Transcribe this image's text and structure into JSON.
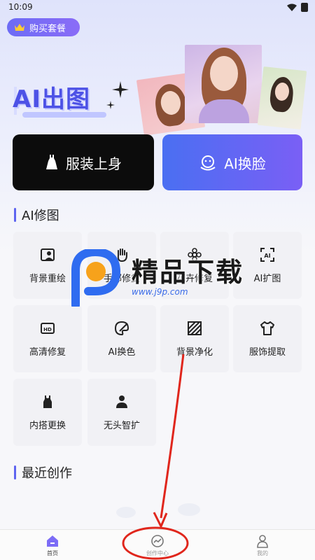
{
  "status": {
    "time": "10:09"
  },
  "header": {
    "buy_label": "购买套餐"
  },
  "banner": {
    "title": "AI出图"
  },
  "actions": {
    "clothes_label": "服装上身",
    "faceswap_label": "AI换脸"
  },
  "retouch": {
    "title": "AI修图",
    "tools": [
      {
        "label": "背景重绘",
        "icon": "portrait-icon"
      },
      {
        "label": "手部修复",
        "icon": "hand-icon"
      },
      {
        "label": "花卉修复",
        "icon": "flower-icon"
      },
      {
        "label": "AI扩图",
        "icon": "expand-icon"
      },
      {
        "label": "高清修复",
        "icon": "hd-icon"
      },
      {
        "label": "AI换色",
        "icon": "palette-icon"
      },
      {
        "label": "背景净化",
        "icon": "stripes-icon"
      },
      {
        "label": "服饰提取",
        "icon": "shirt-icon"
      },
      {
        "label": "内搭更换",
        "icon": "tanktop-icon"
      },
      {
        "label": "无头智扩",
        "icon": "person-icon"
      }
    ]
  },
  "recent": {
    "title": "最近创作"
  },
  "watermark": {
    "text": "精品下载",
    "url": "www.j9p.com"
  },
  "tabbar": {
    "home": "首页",
    "create": "创作中心",
    "mine": "我的"
  },
  "colors": {
    "accent": "#5e64f0",
    "annotation": "#e0261c"
  }
}
